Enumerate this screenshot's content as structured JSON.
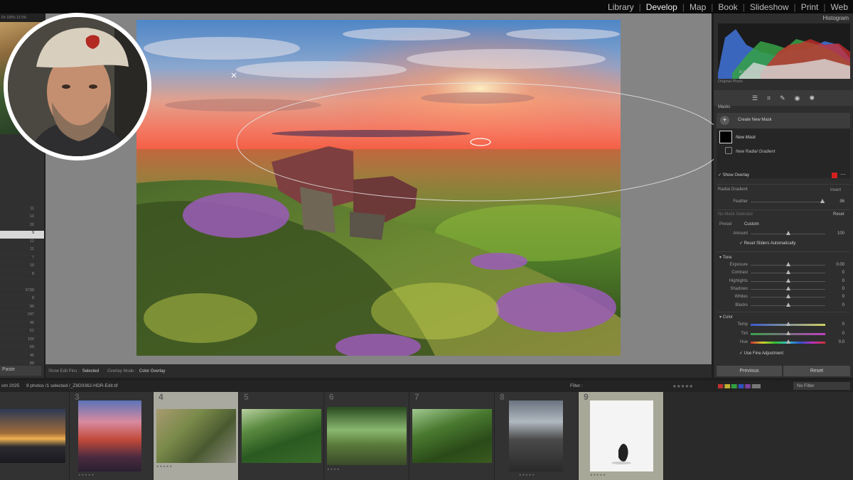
{
  "modules": [
    "Library",
    "Develop",
    "Map",
    "Book",
    "Slideshow",
    "Print",
    "Web"
  ],
  "active_module": "Develop",
  "left_panel": {
    "header_text": "Fit  100%  12.5%",
    "list_values": [
      "",
      "",
      "",
      "",
      "",
      "11",
      "12",
      "20",
      "9",
      "12",
      "11",
      "7",
      "10",
      "8",
      "",
      "5739",
      "8",
      "99",
      "247",
      "45",
      "51",
      "100",
      "69",
      "45",
      "89",
      "54"
    ],
    "selected_index": 8,
    "paste_label": "Paste"
  },
  "edit_toolbar": {
    "show_edit_pins_label": "Show Edit Pins :",
    "show_edit_pins_value": "Selected",
    "overlay_mode_label": "Overlay Mode :",
    "overlay_mode_value": "Color Overlay"
  },
  "right_panel": {
    "histogram_title": "Histogram",
    "readout": "R  99.9   G  100   B  99.3 %",
    "original_photo": "Original Photo",
    "tool_icons": [
      "sliders-icon",
      "crop-icon",
      "heal-icon",
      "redeye-icon",
      "masking-icon"
    ],
    "masks_title": "Masks",
    "create_new_mask": "Create New Mask",
    "mask_name": "New Mask",
    "radial_gradient_name": "New Radial Gradient",
    "show_overlay": "Show Overlay",
    "overlay_color": "#d41f1f",
    "radial_gradient_label": "Radial Gradient",
    "invert_label": "Invert",
    "feather": {
      "label": "Feather",
      "value": "96",
      "fraction": 0.96
    },
    "no_mask_selected": "No Mask Selected",
    "reset_label": "Reset",
    "preset_label": "Preset",
    "preset_value": "Custom",
    "amount": {
      "label": "Amount",
      "value": "100",
      "fraction": 0.5
    },
    "reset_sliders": "Reset Sliders Automatically",
    "tone_title": "Tone",
    "tone_sliders": [
      {
        "label": "Exposure",
        "value": "0.00",
        "fraction": 0.5
      },
      {
        "label": "Contrast",
        "value": "0",
        "fraction": 0.5
      },
      {
        "label": "Highlights",
        "value": "0",
        "fraction": 0.5
      },
      {
        "label": "Shadows",
        "value": "0",
        "fraction": 0.5
      },
      {
        "label": "Whites",
        "value": "0",
        "fraction": 0.5
      },
      {
        "label": "Blacks",
        "value": "0",
        "fraction": 0.5
      }
    ],
    "color_title": "Color",
    "color_sliders": [
      {
        "label": "Temp",
        "value": "0",
        "fraction": 0.5
      },
      {
        "label": "Tint",
        "value": "0",
        "fraction": 0.5
      },
      {
        "label": "Hue",
        "value": "0.0",
        "fraction": 0.5
      }
    ],
    "fine_adjustment": "Use Fine Adjustment",
    "previous_button": "Previous",
    "reset_button": "Reset"
  },
  "filmstrip_bar": {
    "path_prefix": "om 2025",
    "photo_count": "9 photos /1 selected /_Z8D0362-HDR-Edit.tif",
    "filter_label": "Filter :",
    "no_filter": "No Filter"
  },
  "filmstrip": [
    {
      "number": "",
      "stars": ""
    },
    {
      "number": "3",
      "stars": "★★★★★"
    },
    {
      "number": "4",
      "stars": "★★★★★"
    },
    {
      "number": "5",
      "stars": ""
    },
    {
      "number": "6",
      "stars": "★★★★"
    },
    {
      "number": "7",
      "stars": ""
    },
    {
      "number": "8",
      "stars": "★★★★★"
    },
    {
      "number": "9",
      "stars": "★★★★★"
    }
  ]
}
